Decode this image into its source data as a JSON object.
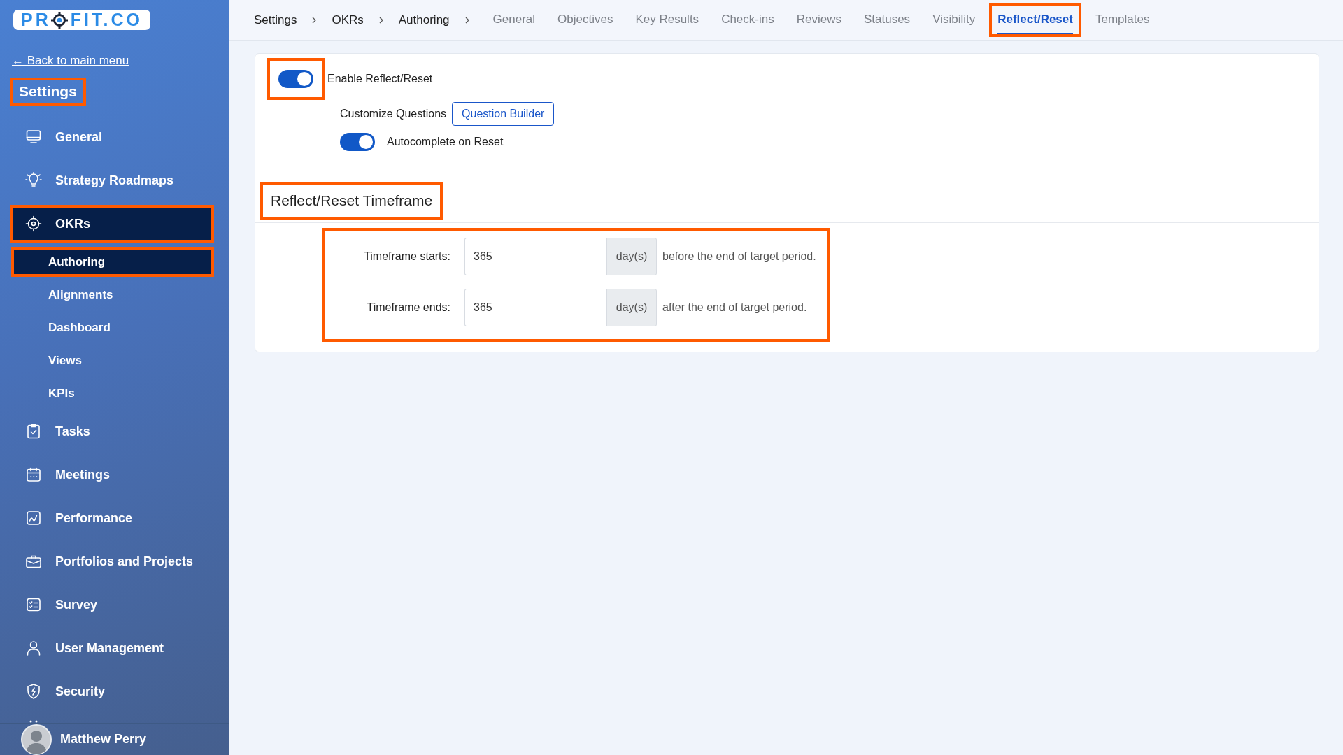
{
  "sidebar": {
    "logo": [
      "PR",
      "FIT.CO"
    ],
    "back_link": "← Back to main menu",
    "title": {
      "text": "Settings",
      "highlighted": true
    },
    "items": [
      {
        "label": "General",
        "selected": false,
        "highlighted": false
      },
      {
        "label": "Strategy Roadmaps",
        "selected": false,
        "highlighted": false
      },
      {
        "label": "OKRs",
        "selected": true,
        "highlighted": true,
        "children": [
          {
            "label": "Authoring",
            "selected": true,
            "highlighted": true
          },
          {
            "label": "Alignments",
            "selected": false,
            "highlighted": false
          },
          {
            "label": "Dashboard",
            "selected": false,
            "highlighted": false
          },
          {
            "label": "Views",
            "selected": false,
            "highlighted": false
          },
          {
            "label": "KPIs",
            "selected": false,
            "highlighted": false
          }
        ]
      },
      {
        "label": "Tasks",
        "selected": false,
        "highlighted": false
      },
      {
        "label": "Meetings",
        "selected": false,
        "highlighted": false
      },
      {
        "label": "Performance",
        "selected": false,
        "highlighted": false
      },
      {
        "label": "Portfolios and Projects",
        "selected": false,
        "highlighted": false
      },
      {
        "label": "Survey",
        "selected": false,
        "highlighted": false
      },
      {
        "label": "User Management",
        "selected": false,
        "highlighted": false
      },
      {
        "label": "Security",
        "selected": false,
        "highlighted": false
      }
    ],
    "user": {
      "name": "Matthew Perry"
    }
  },
  "breadcrumb": [
    "Settings",
    "OKRs",
    "Authoring"
  ],
  "tabs": [
    {
      "label": "General",
      "selected": false,
      "highlighted": false
    },
    {
      "label": "Objectives",
      "selected": false,
      "highlighted": false
    },
    {
      "label": "Key Results",
      "selected": false,
      "highlighted": false
    },
    {
      "label": "Check-ins",
      "selected": false,
      "highlighted": false
    },
    {
      "label": "Reviews",
      "selected": false,
      "highlighted": false
    },
    {
      "label": "Statuses",
      "selected": false,
      "highlighted": false
    },
    {
      "label": "Visibility",
      "selected": false,
      "highlighted": false
    },
    {
      "label": "Reflect/Reset",
      "selected": true,
      "highlighted": true
    },
    {
      "label": "Templates",
      "selected": false,
      "highlighted": false
    }
  ],
  "enable": {
    "label": "Enable Reflect/Reset",
    "on": true,
    "highlighted": true
  },
  "customize": {
    "label": "Customize Questions",
    "button": "Question Builder"
  },
  "autocomplete": {
    "label": "Autocomplete on Reset",
    "on": true
  },
  "timeframe": {
    "heading": "Reflect/Reset Timeframe",
    "heading_highlighted": true,
    "form_highlighted": true,
    "rows": [
      {
        "label": "Timeframe starts:",
        "value": "365",
        "unit": "day(s)",
        "note": "before the end of target period."
      },
      {
        "label": "Timeframe ends:",
        "value": "365",
        "unit": "day(s)",
        "note": "after the end of target period."
      }
    ]
  }
}
